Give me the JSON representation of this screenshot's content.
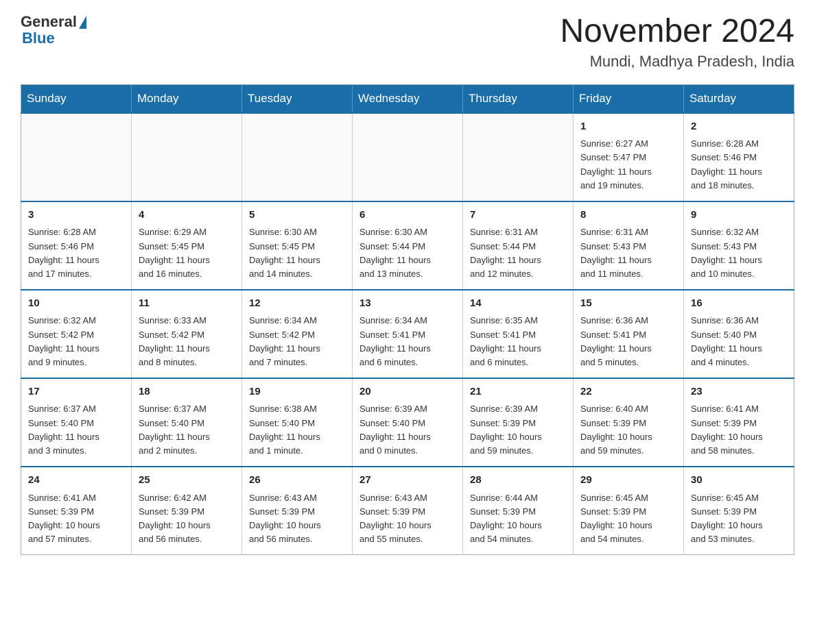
{
  "header": {
    "logo_general": "General",
    "logo_blue": "Blue",
    "title": "November 2024",
    "subtitle": "Mundi, Madhya Pradesh, India"
  },
  "days_of_week": [
    "Sunday",
    "Monday",
    "Tuesday",
    "Wednesday",
    "Thursday",
    "Friday",
    "Saturday"
  ],
  "weeks": [
    [
      {
        "day": "",
        "info": ""
      },
      {
        "day": "",
        "info": ""
      },
      {
        "day": "",
        "info": ""
      },
      {
        "day": "",
        "info": ""
      },
      {
        "day": "",
        "info": ""
      },
      {
        "day": "1",
        "info": "Sunrise: 6:27 AM\nSunset: 5:47 PM\nDaylight: 11 hours\nand 19 minutes."
      },
      {
        "day": "2",
        "info": "Sunrise: 6:28 AM\nSunset: 5:46 PM\nDaylight: 11 hours\nand 18 minutes."
      }
    ],
    [
      {
        "day": "3",
        "info": "Sunrise: 6:28 AM\nSunset: 5:46 PM\nDaylight: 11 hours\nand 17 minutes."
      },
      {
        "day": "4",
        "info": "Sunrise: 6:29 AM\nSunset: 5:45 PM\nDaylight: 11 hours\nand 16 minutes."
      },
      {
        "day": "5",
        "info": "Sunrise: 6:30 AM\nSunset: 5:45 PM\nDaylight: 11 hours\nand 14 minutes."
      },
      {
        "day": "6",
        "info": "Sunrise: 6:30 AM\nSunset: 5:44 PM\nDaylight: 11 hours\nand 13 minutes."
      },
      {
        "day": "7",
        "info": "Sunrise: 6:31 AM\nSunset: 5:44 PM\nDaylight: 11 hours\nand 12 minutes."
      },
      {
        "day": "8",
        "info": "Sunrise: 6:31 AM\nSunset: 5:43 PM\nDaylight: 11 hours\nand 11 minutes."
      },
      {
        "day": "9",
        "info": "Sunrise: 6:32 AM\nSunset: 5:43 PM\nDaylight: 11 hours\nand 10 minutes."
      }
    ],
    [
      {
        "day": "10",
        "info": "Sunrise: 6:32 AM\nSunset: 5:42 PM\nDaylight: 11 hours\nand 9 minutes."
      },
      {
        "day": "11",
        "info": "Sunrise: 6:33 AM\nSunset: 5:42 PM\nDaylight: 11 hours\nand 8 minutes."
      },
      {
        "day": "12",
        "info": "Sunrise: 6:34 AM\nSunset: 5:42 PM\nDaylight: 11 hours\nand 7 minutes."
      },
      {
        "day": "13",
        "info": "Sunrise: 6:34 AM\nSunset: 5:41 PM\nDaylight: 11 hours\nand 6 minutes."
      },
      {
        "day": "14",
        "info": "Sunrise: 6:35 AM\nSunset: 5:41 PM\nDaylight: 11 hours\nand 6 minutes."
      },
      {
        "day": "15",
        "info": "Sunrise: 6:36 AM\nSunset: 5:41 PM\nDaylight: 11 hours\nand 5 minutes."
      },
      {
        "day": "16",
        "info": "Sunrise: 6:36 AM\nSunset: 5:40 PM\nDaylight: 11 hours\nand 4 minutes."
      }
    ],
    [
      {
        "day": "17",
        "info": "Sunrise: 6:37 AM\nSunset: 5:40 PM\nDaylight: 11 hours\nand 3 minutes."
      },
      {
        "day": "18",
        "info": "Sunrise: 6:37 AM\nSunset: 5:40 PM\nDaylight: 11 hours\nand 2 minutes."
      },
      {
        "day": "19",
        "info": "Sunrise: 6:38 AM\nSunset: 5:40 PM\nDaylight: 11 hours\nand 1 minute."
      },
      {
        "day": "20",
        "info": "Sunrise: 6:39 AM\nSunset: 5:40 PM\nDaylight: 11 hours\nand 0 minutes."
      },
      {
        "day": "21",
        "info": "Sunrise: 6:39 AM\nSunset: 5:39 PM\nDaylight: 10 hours\nand 59 minutes."
      },
      {
        "day": "22",
        "info": "Sunrise: 6:40 AM\nSunset: 5:39 PM\nDaylight: 10 hours\nand 59 minutes."
      },
      {
        "day": "23",
        "info": "Sunrise: 6:41 AM\nSunset: 5:39 PM\nDaylight: 10 hours\nand 58 minutes."
      }
    ],
    [
      {
        "day": "24",
        "info": "Sunrise: 6:41 AM\nSunset: 5:39 PM\nDaylight: 10 hours\nand 57 minutes."
      },
      {
        "day": "25",
        "info": "Sunrise: 6:42 AM\nSunset: 5:39 PM\nDaylight: 10 hours\nand 56 minutes."
      },
      {
        "day": "26",
        "info": "Sunrise: 6:43 AM\nSunset: 5:39 PM\nDaylight: 10 hours\nand 56 minutes."
      },
      {
        "day": "27",
        "info": "Sunrise: 6:43 AM\nSunset: 5:39 PM\nDaylight: 10 hours\nand 55 minutes."
      },
      {
        "day": "28",
        "info": "Sunrise: 6:44 AM\nSunset: 5:39 PM\nDaylight: 10 hours\nand 54 minutes."
      },
      {
        "day": "29",
        "info": "Sunrise: 6:45 AM\nSunset: 5:39 PM\nDaylight: 10 hours\nand 54 minutes."
      },
      {
        "day": "30",
        "info": "Sunrise: 6:45 AM\nSunset: 5:39 PM\nDaylight: 10 hours\nand 53 minutes."
      }
    ]
  ]
}
